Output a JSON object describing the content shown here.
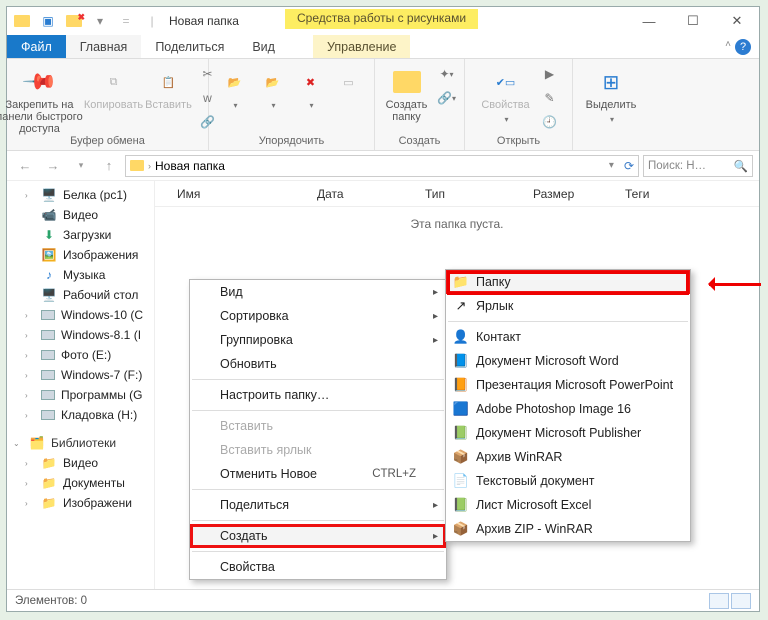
{
  "title": "Новая папка",
  "context_tab": "Средства работы с рисунками",
  "tabs": {
    "file": "Файл",
    "home": "Главная",
    "share": "Поделиться",
    "view": "Вид",
    "manage": "Управление"
  },
  "ribbon": {
    "g1": {
      "pin": "Закрепить на панели быстрого доступа",
      "copy": "Копировать",
      "paste": "Вставить",
      "label": "Буфер обмена"
    },
    "g2": {
      "label": "Упорядочить"
    },
    "g3": {
      "new": "Создать папку",
      "label": "Создать"
    },
    "g4": {
      "props": "Свойства",
      "label": "Открыть"
    },
    "g5": {
      "select": "Выделить"
    }
  },
  "breadcrumb": "Новая папка",
  "search_placeholder": "Поиск: Н…",
  "columns": {
    "name": "Имя",
    "date": "Дата",
    "type": "Тип",
    "size": "Размер",
    "tags": "Теги"
  },
  "empty_msg": "Эта папка пуста.",
  "nav": [
    "Белка (pc1)",
    "Видео",
    "Загрузки",
    "Изображения",
    "Музыка",
    "Рабочий стол",
    "Windows-10 (C",
    "Windows-8.1 (I",
    "Фото (E:)",
    "Windows-7 (F:)",
    "Программы (G",
    "Кладовка (H:)"
  ],
  "nav_lib": "Библиотеки",
  "nav_lib_items": [
    "Видео",
    "Документы",
    "Изображени"
  ],
  "menu1": [
    {
      "t": "Вид",
      "a": true
    },
    {
      "t": "Сортировка",
      "a": true
    },
    {
      "t": "Группировка",
      "a": true
    },
    {
      "t": "Обновить"
    },
    {
      "sep": true
    },
    {
      "t": "Настроить папку…"
    },
    {
      "sep": true
    },
    {
      "t": "Вставить",
      "d": true
    },
    {
      "t": "Вставить ярлык",
      "d": true
    },
    {
      "t": "Отменить Новое",
      "hk": "CTRL+Z"
    },
    {
      "sep": true
    },
    {
      "t": "Поделиться",
      "a": true
    },
    {
      "sep": true
    },
    {
      "t": "Создать",
      "a": true,
      "hi": true
    },
    {
      "sep": true
    },
    {
      "t": "Свойства"
    }
  ],
  "menu2": [
    {
      "t": "Папку",
      "ic": "📁",
      "hi": true
    },
    {
      "t": "Ярлык",
      "ic": "↗"
    },
    {
      "sep": true
    },
    {
      "t": "Контакт",
      "ic": "👤"
    },
    {
      "t": "Документ Microsoft Word",
      "ic": "📘"
    },
    {
      "t": "Презентация Microsoft PowerPoint",
      "ic": "📙"
    },
    {
      "t": "Adobe Photoshop Image 16",
      "ic": "🟦"
    },
    {
      "t": "Документ Microsoft Publisher",
      "ic": "📗"
    },
    {
      "t": "Архив WinRAR",
      "ic": "📦"
    },
    {
      "t": "Текстовый документ",
      "ic": "📄"
    },
    {
      "t": "Лист Microsoft Excel",
      "ic": "📗"
    },
    {
      "t": "Архив ZIP - WinRAR",
      "ic": "📦"
    }
  ],
  "status": "Элементов: 0"
}
